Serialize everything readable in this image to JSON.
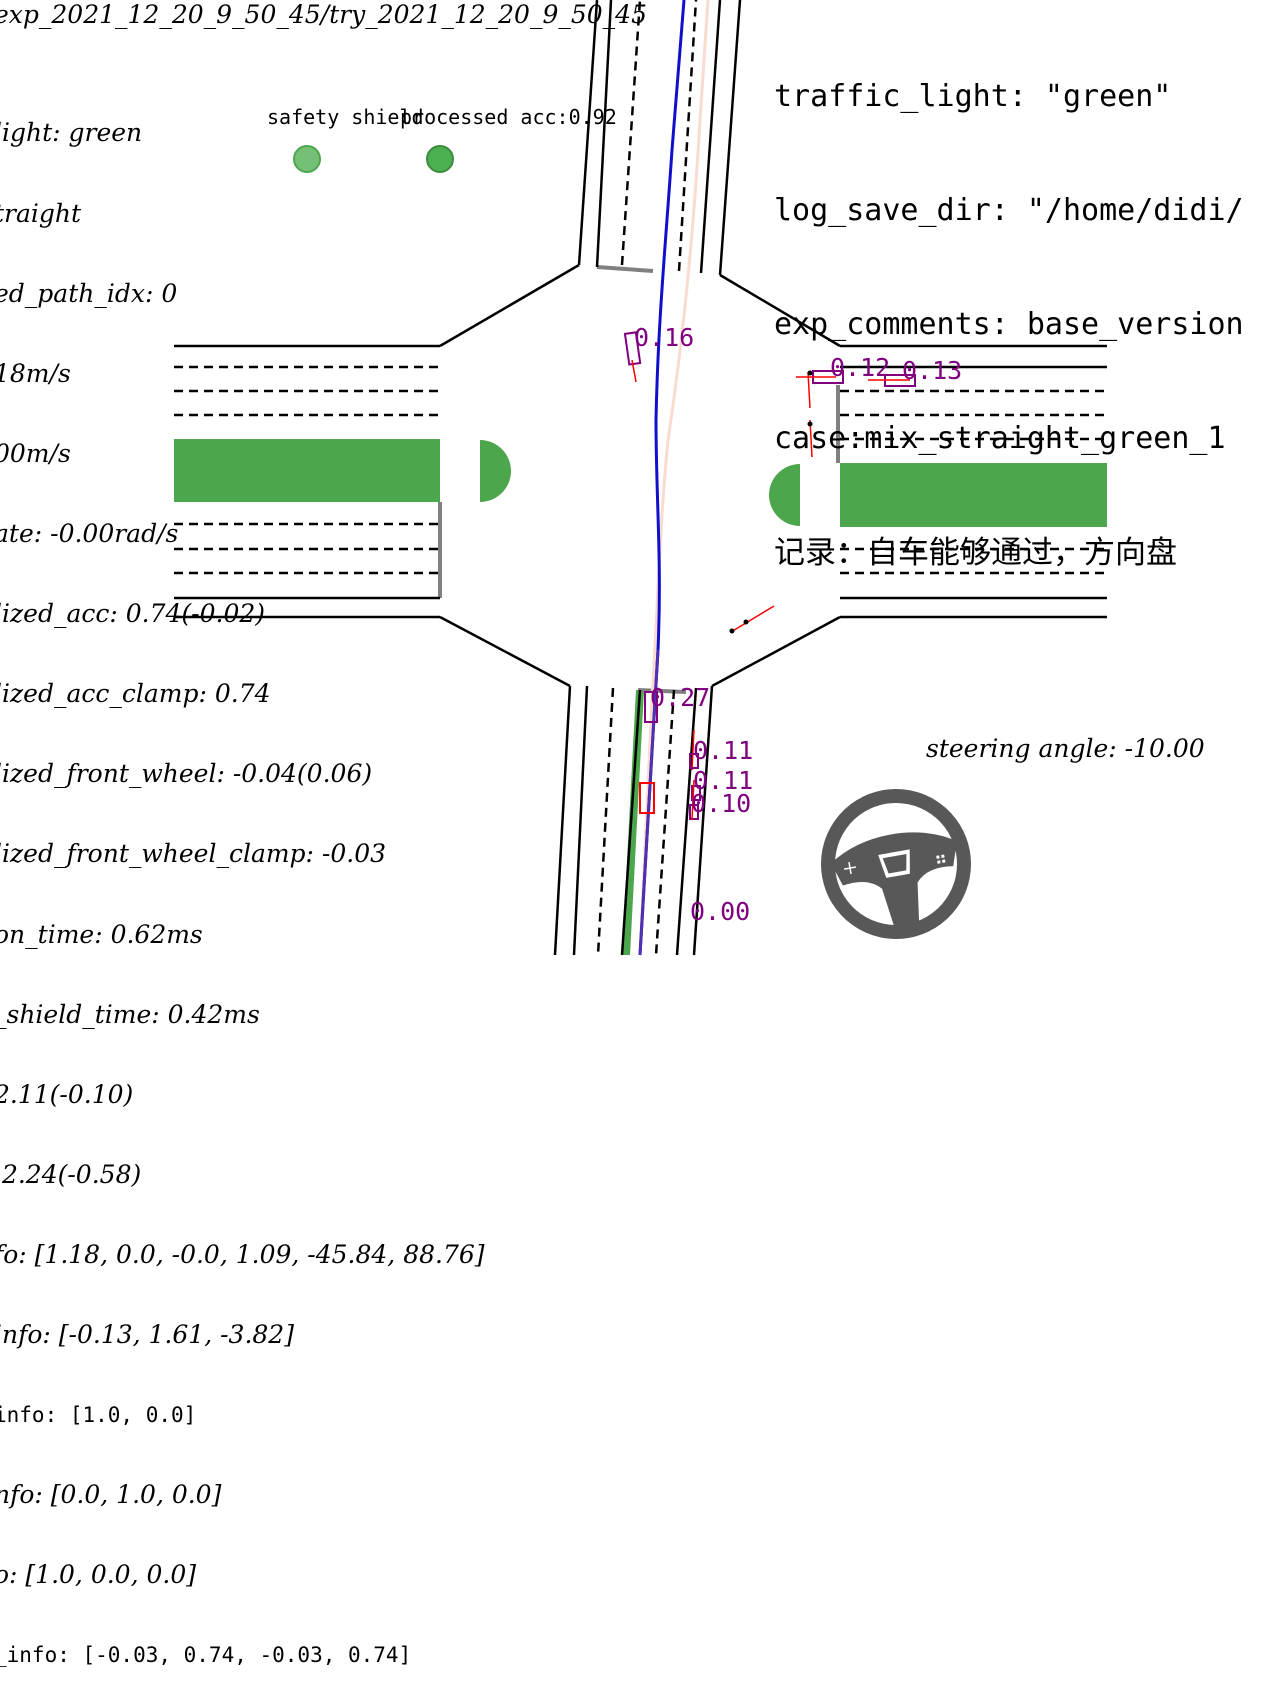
{
  "header": {
    "path_title": "exp_2021_12_20_9_50_45/try_2021_12_20_9_50_45"
  },
  "info_lines": [
    "light: green",
    "traight",
    "ed_path_idx: 0",
    "18m/s",
    "00m/s",
    "ate: -0.00rad/s",
    "lized_acc: 0.74(-0.02)",
    "lized_acc_clamp: 0.74",
    "lized_front_wheel: -0.04(0.06)",
    "lized_front_wheel_clamp: -0.03",
    "on_time: 0.62ms",
    "_shield_time: 0.42ms",
    "2.11(-0.10)",
    " 2.24(-0.58)",
    "fo: [1.18, 0.0, -0.0, 1.09, -45.84, 88.76]",
    "info: [-0.13, 1.61, -3.82]",
    "info: [1.0, 0.0]",
    "nfo: [0.0, 1.0, 0.0]",
    "o: [1.0, 0.0, 0.0]",
    "_info: [-0.03, 0.74, -0.03, 0.74]"
  ],
  "config_lines": [
    "traffic_light: \"green\"",
    "log_save_dir: \"/home/didi/",
    "exp_comments: base_version",
    "case:mix_straight_green_1",
    "记录：自车能够通过，方向盘"
  ],
  "signals": {
    "safety_shield_label": "safety shield",
    "processed_acc_label": "processed acc:0.92",
    "safety_shield_color": "#76bf76",
    "processed_acc_color": "#4caf50"
  },
  "object_labels": [
    "0.16",
    "0.12",
    "0.13",
    "0.27",
    "0.11",
    "0.11",
    "0.10",
    "0.00"
  ],
  "steering": {
    "label": "steering angle: -10.00",
    "icon": "steering-wheel-icon"
  },
  "colors": {
    "road": "#000000",
    "lane_green": "#4ca64c",
    "stop_line": "#808080",
    "planned_path": "#0000cc",
    "reference_path": "#fadbd0",
    "object_label": "#800080",
    "obstacle": "#ff0000"
  }
}
